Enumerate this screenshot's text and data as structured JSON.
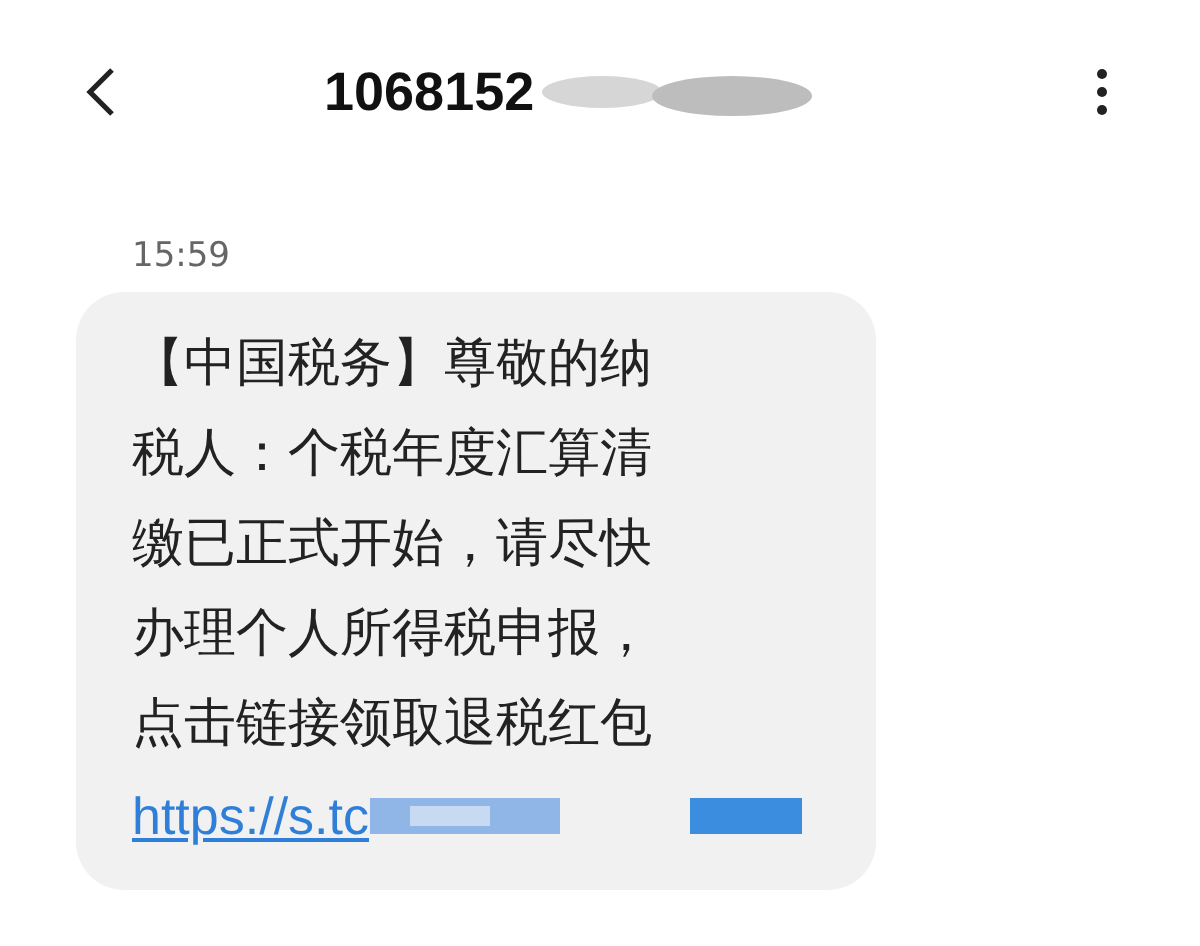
{
  "header": {
    "title": "1068152"
  },
  "timestamp": "15:59",
  "message": {
    "text": "【中国税务】尊敬的纳税人：个税年度汇算清缴已正式开始，请尽快办理个人所得税申报，点击链接领取退税红包",
    "link": "https://s.tc"
  }
}
